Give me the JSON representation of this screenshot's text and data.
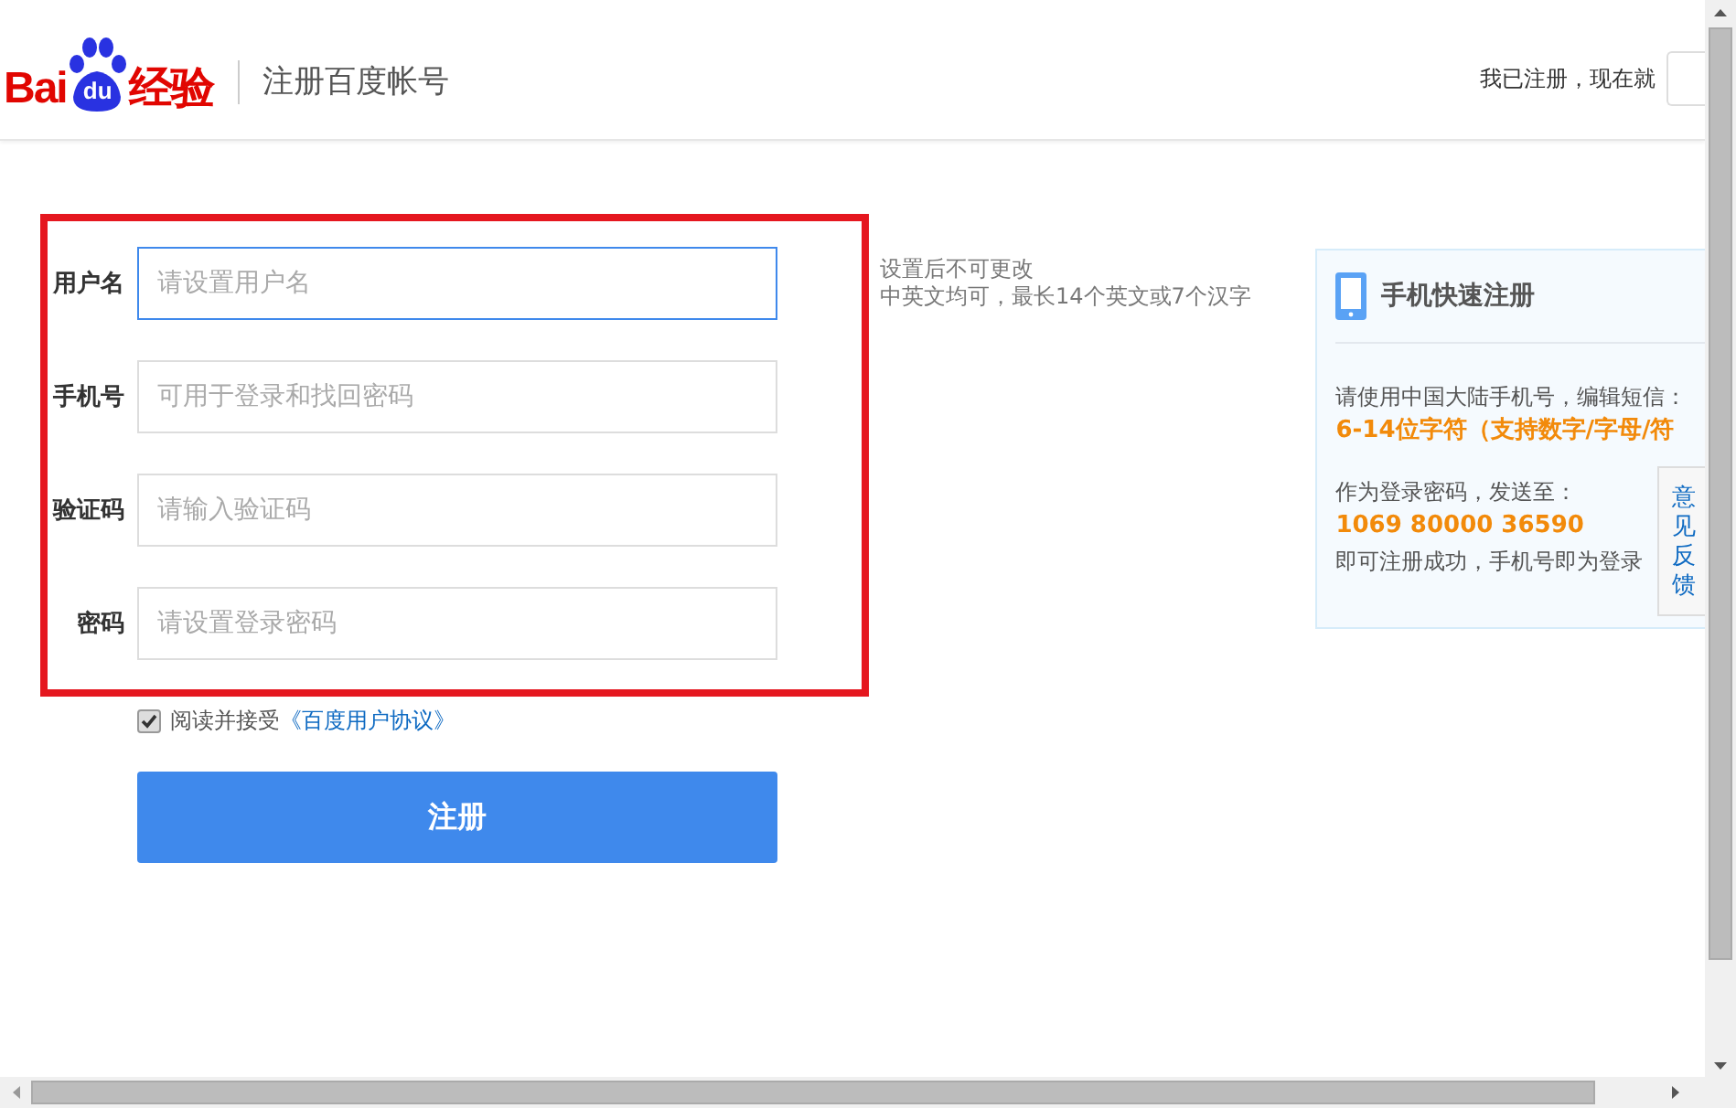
{
  "header": {
    "logo": {
      "left": "Bai",
      "paw": "du",
      "right": "经验"
    },
    "title": "注册百度帐号",
    "login_prompt": "我已注册，现在就"
  },
  "form": {
    "fields": [
      {
        "label": "用户名",
        "placeholder": "请设置用户名",
        "focused": true,
        "hint": [
          "设置后不可更改",
          "中英文均可，最长14个英文或7个汉字"
        ]
      },
      {
        "label": "手机号",
        "placeholder": "可用于登录和找回密码",
        "focused": false
      },
      {
        "label": "验证码",
        "placeholder": "请输入验证码",
        "focused": false
      },
      {
        "label": "密码",
        "placeholder": "请设置登录密码",
        "focused": false
      }
    ],
    "agreement": {
      "checked": true,
      "text": "阅读并接受",
      "link": "《百度用户协议》"
    },
    "submit": "注册"
  },
  "side_panel": {
    "title": "手机快速注册",
    "line_1": "请使用中国大陆手机号，编辑短信：",
    "sms_text": "6-14位字符（支持数字/字母/符",
    "line_2": "作为登录密码，发送至：",
    "number": "1069 80000 36590",
    "line_3": "即可注册成功，手机号即为登录"
  },
  "feedback_tab": "意见反馈"
}
